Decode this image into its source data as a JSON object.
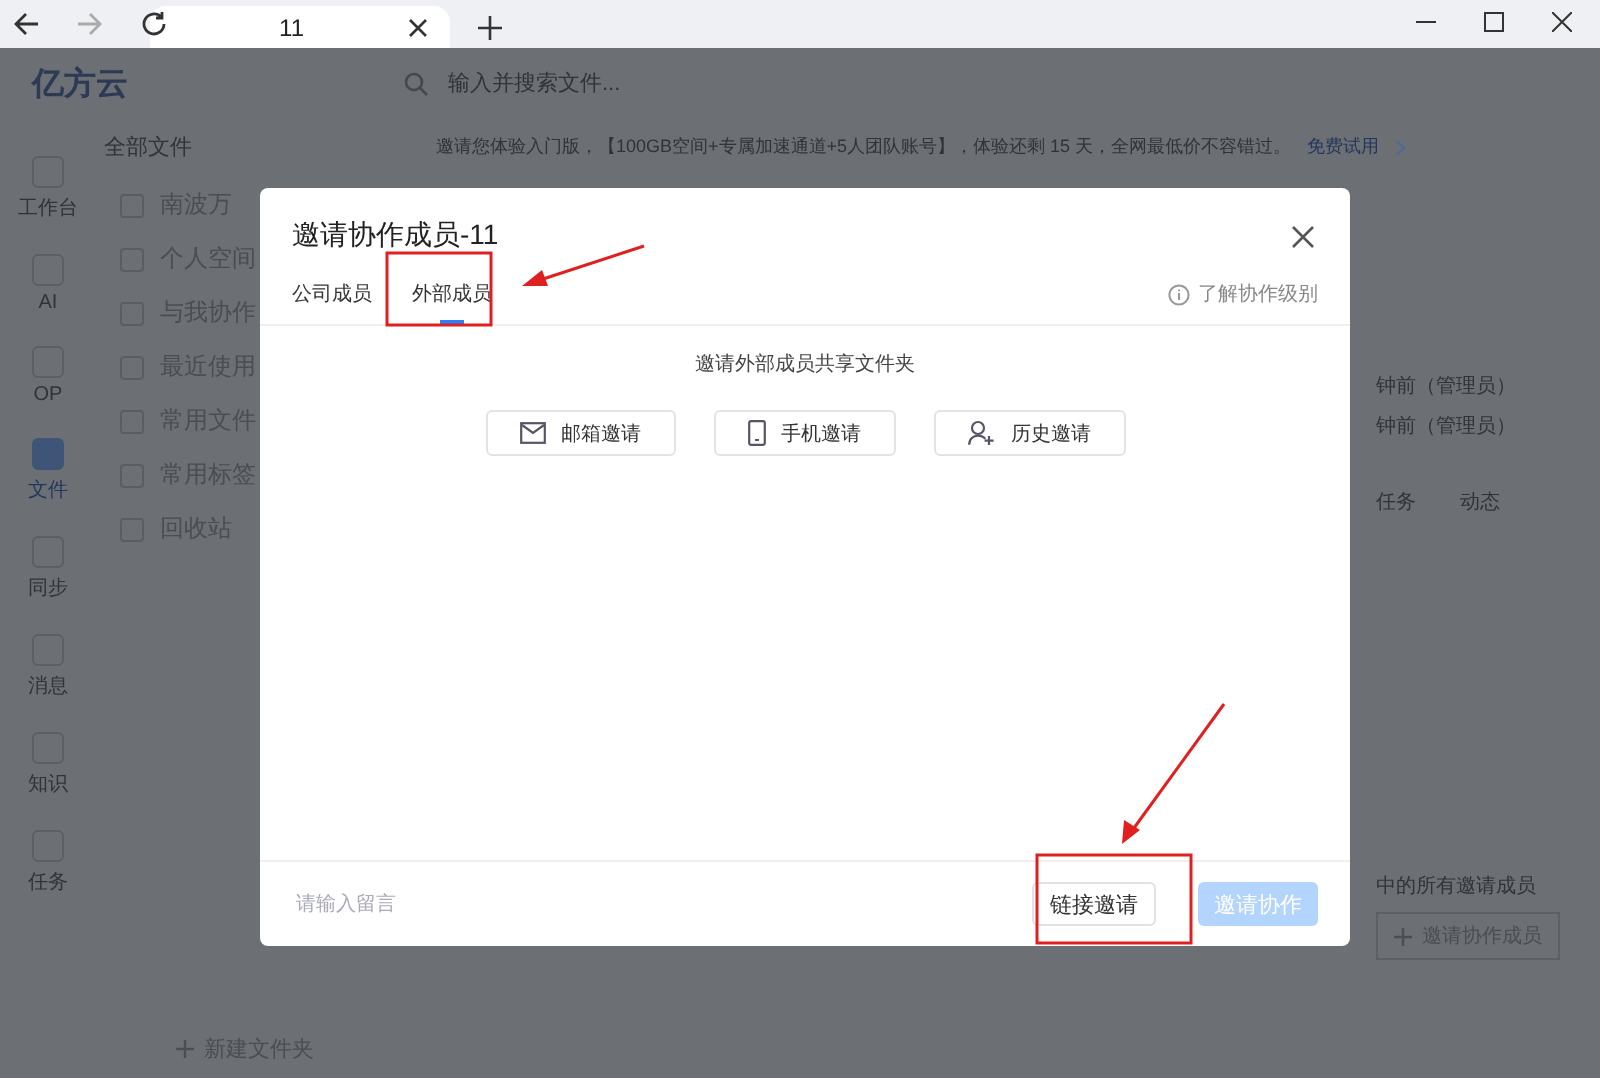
{
  "browser": {
    "tab_title": "11"
  },
  "app": {
    "logo": "亿方云",
    "search_placeholder": "输入并搜索文件...",
    "banner": {
      "text": "邀请您体验入门版，【100GB空间+专属加速通道+5人团队账号】，体验还剩 15 天，全网最低价不容错过。",
      "link": "免费试用"
    },
    "rail": [
      {
        "label": "工作台",
        "selected": false
      },
      {
        "label": "AI",
        "selected": false
      },
      {
        "label": "OP",
        "selected": false
      },
      {
        "label": "文件",
        "selected": true
      },
      {
        "label": "同步",
        "selected": false
      },
      {
        "label": "消息",
        "selected": false
      },
      {
        "label": "知识",
        "selected": false
      },
      {
        "label": "任务",
        "selected": false
      }
    ],
    "sidebar": {
      "header": "全部文件",
      "items": [
        {
          "label": "南波万"
        },
        {
          "label": "个人空间"
        },
        {
          "label": "与我协作"
        },
        {
          "label": "最近使用"
        },
        {
          "label": "常用文件"
        },
        {
          "label": "常用标签"
        },
        {
          "label": "回收站"
        }
      ],
      "new_folder": "新建文件夹"
    },
    "right_panel": {
      "activity": [
        "钟前（管理员）",
        "钟前（管理员）"
      ],
      "tabs": [
        "任务",
        "动态"
      ],
      "note": "中的所有邀请成员",
      "invite_button": "邀请协作成员"
    }
  },
  "dialog": {
    "title": "邀请协作成员-11",
    "tabs": [
      {
        "label": "公司成员",
        "selected": false
      },
      {
        "label": "外部成员",
        "selected": true
      }
    ],
    "help_link": "了解协作级别",
    "subtitle": "邀请外部成员共享文件夹",
    "invite_options": [
      {
        "kind": "email",
        "label": "邮箱邀请"
      },
      {
        "kind": "phone",
        "label": "手机邀请"
      },
      {
        "kind": "history",
        "label": "历史邀请"
      }
    ],
    "message_placeholder": "请输入留言",
    "buttons": [
      {
        "kind": "secondary",
        "label": "链接邀请",
        "disabled": false
      },
      {
        "kind": "primary",
        "label": "邀请协作",
        "disabled": true
      }
    ]
  }
}
